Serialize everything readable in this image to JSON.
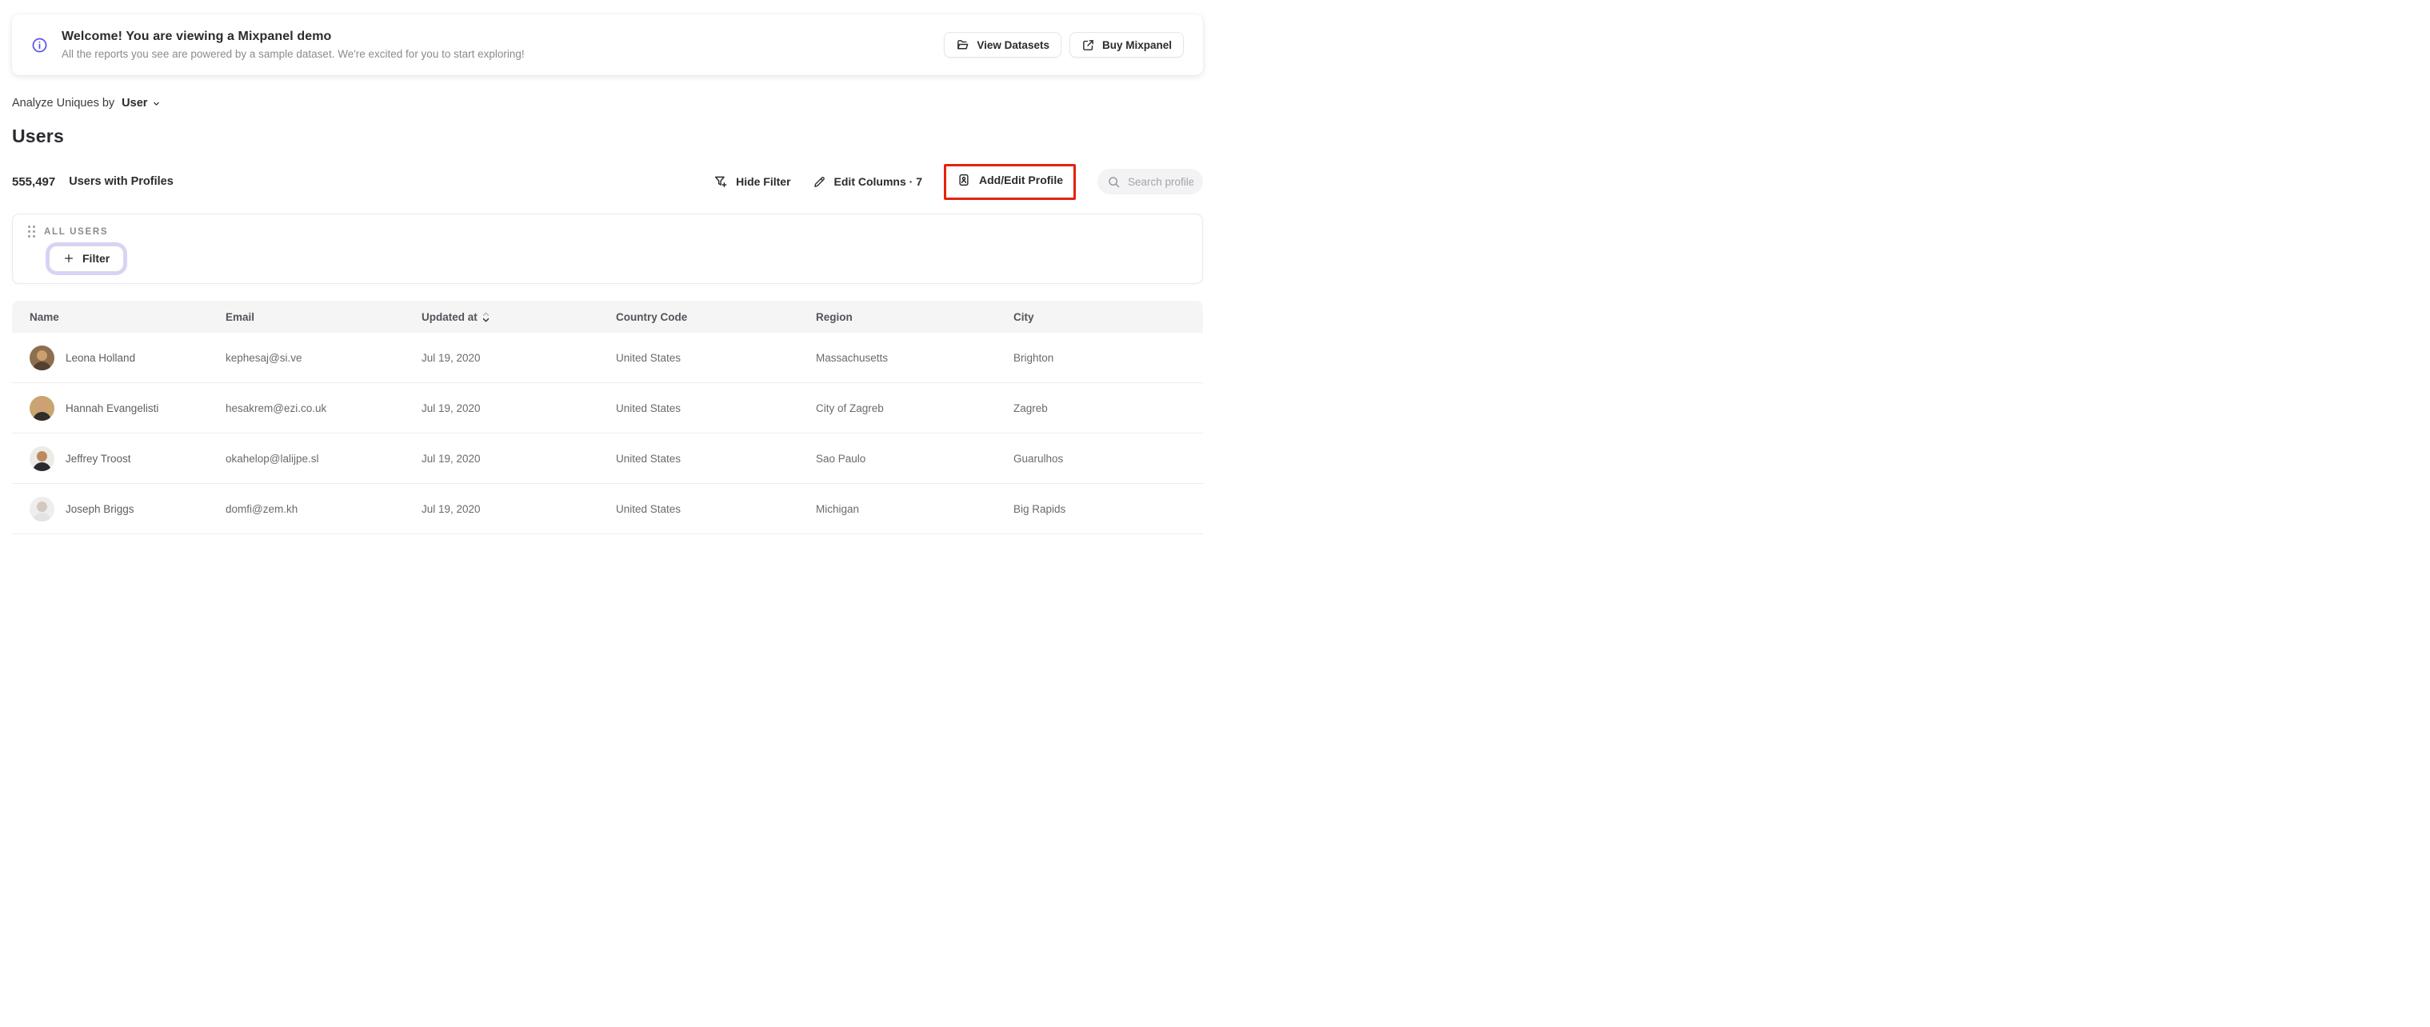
{
  "banner": {
    "title": "Welcome! You are viewing a Mixpanel demo",
    "subtitle": "All the reports you see are powered by a sample dataset. We're excited for you to start exploring!",
    "buttons": [
      {
        "label": "View Datasets",
        "icon": "folder-open-icon"
      },
      {
        "label": "Buy Mixpanel",
        "icon": "external-link-icon"
      }
    ]
  },
  "analyze_bar": {
    "prefix": "Analyze Uniques by",
    "selected": "User"
  },
  "page": {
    "title": "Users"
  },
  "stats": {
    "count": "555,497",
    "label": "Users with Profiles"
  },
  "toolbar": {
    "hide_filter_label": "Hide Filter",
    "edit_columns_label": "Edit Columns · 7",
    "add_edit_profile_label": "Add/Edit Profile",
    "highlight_color": "#e4220c",
    "search": {
      "placeholder": "Search profiles"
    }
  },
  "filter_panel": {
    "group_label": "ALL USERS",
    "add_filter_label": "Filter",
    "focus_ring_color": "#d7d3f7"
  },
  "colors": {
    "accent_purple": "#5a4ff0",
    "annotation_red": "#e4220c"
  },
  "table": {
    "columns": [
      {
        "label": "Name"
      },
      {
        "label": "Email"
      },
      {
        "label": "Updated at",
        "sorted": "desc"
      },
      {
        "label": "Country Code"
      },
      {
        "label": "Region"
      },
      {
        "label": "City"
      }
    ],
    "rows": [
      {
        "name": "Leona Holland",
        "email": "kephesaj@si.ve",
        "updated_at": "Jul 19, 2020",
        "country_code": "United States",
        "region": "Massachusetts",
        "city": "Brighton",
        "avatar": {
          "bg": "#8d6f50",
          "head": "#caa06f",
          "body": "#54402f"
        }
      },
      {
        "name": "Hannah Evangelisti",
        "email": "hesakrem@ezi.co.uk",
        "updated_at": "Jul 19, 2020",
        "country_code": "United States",
        "region": "City of Zagreb",
        "city": "Zagreb",
        "avatar": {
          "bg": "#c8a571",
          "head": "#cfa077",
          "body": "#302d2a"
        }
      },
      {
        "name": "Jeffrey Troost",
        "email": "okahelop@lalijpe.sl",
        "updated_at": "Jul 19, 2020",
        "country_code": "United States",
        "region": "Sao Paulo",
        "city": "Guarulhos",
        "avatar": {
          "bg": "#edebe7",
          "head": "#bc8a5e",
          "body": "#2a2a33"
        }
      },
      {
        "name": "Joseph Briggs",
        "email": "domfi@zem.kh",
        "updated_at": "Jul 19, 2020",
        "country_code": "United States",
        "region": "Michigan",
        "city": "Big Rapids",
        "avatar": {
          "bg": "#eeeeef",
          "head": "#d3c8bf",
          "body": "#e3e3e4"
        }
      }
    ]
  }
}
